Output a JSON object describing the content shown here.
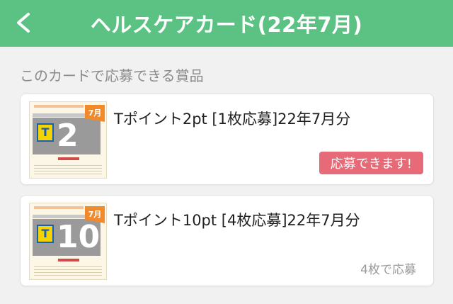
{
  "header": {
    "back_icon": "chevron-left-icon",
    "title": "ヘルスケアカード(22年7月)",
    "background": "#5cc283"
  },
  "section": {
    "label": "このカードで応募できる賞品"
  },
  "prizes": [
    {
      "title": "Tポイント2pt [1枚応募]22年7月分",
      "thumb_number": "2",
      "thumb_ribbon": "7月",
      "thumb_logo": "T",
      "status_badge": "応募できます!",
      "status_color": "#e66a77"
    },
    {
      "title": "Tポイント10pt [4枚応募]22年7月分",
      "thumb_number": "10",
      "thumb_ribbon": "7月",
      "thumb_logo": "T",
      "status_text": "4枚で応募"
    }
  ]
}
